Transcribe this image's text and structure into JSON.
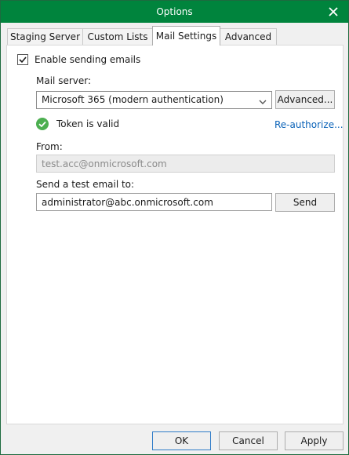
{
  "window": {
    "title": "Options"
  },
  "tabs": [
    {
      "label": "Staging Server"
    },
    {
      "label": "Custom Lists"
    },
    {
      "label": "Mail Settings"
    },
    {
      "label": "Advanced"
    }
  ],
  "mail": {
    "enable_label": "Enable sending emails",
    "enable_checked": true,
    "server_label": "Mail server:",
    "server_value": "Microsoft 365 (modern authentication)",
    "advanced_button": "Advanced...",
    "token_status": "Token is valid",
    "reauthorize_link": "Re-authorize...",
    "from_label": "From:",
    "from_value": "test.acc@onmicrosoft.com",
    "test_label": "Send a test email to:",
    "test_value": "administrator@abc.onmicrosoft.com",
    "send_button": "Send"
  },
  "footer": {
    "ok": "OK",
    "cancel": "Cancel",
    "apply": "Apply"
  },
  "colors": {
    "titlebar": "#00843D",
    "link": "#0B63B8",
    "token_ok": "#4CAF50"
  }
}
